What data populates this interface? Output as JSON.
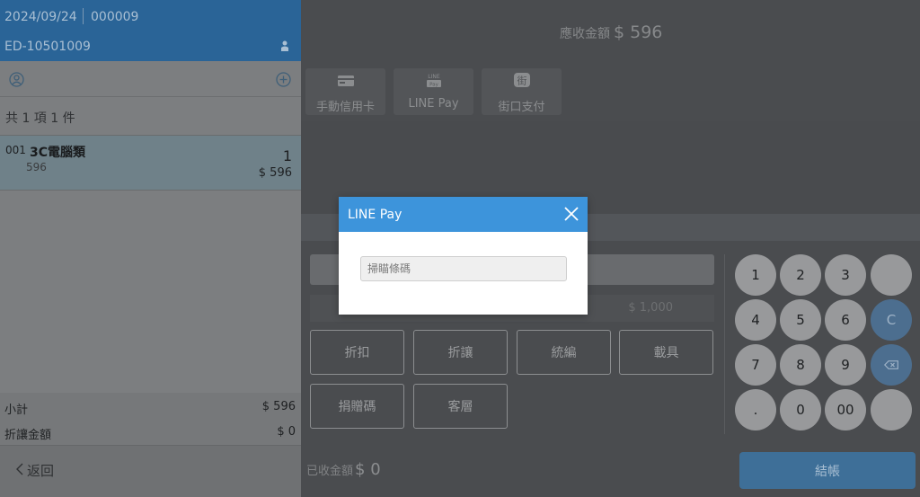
{
  "header": {
    "date": "2024/09/24",
    "order_no": "000009",
    "terminal": "ED-10501009"
  },
  "cart": {
    "count_text": "共 1 項 1 件",
    "items": [
      {
        "no": "001",
        "name": "3C電腦類",
        "unit_price": "596",
        "qty": "1",
        "amount": "$ 596"
      }
    ]
  },
  "totals": {
    "subtotal_label": "小計",
    "subtotal_value": "$ 596",
    "discount_label": "折讓金額",
    "discount_value": "$ 0"
  },
  "footer": {
    "back_label": "返回"
  },
  "payment": {
    "due_label": "應收金額",
    "due_amount": "$ 596",
    "methods": [
      {
        "label": "手動信用卡",
        "icon": "card-icon"
      },
      {
        "label": "LINE Pay",
        "icon": "line-pay-icon",
        "icon_text_top": "LINE",
        "icon_text_bottom": "Pay"
      },
      {
        "label": "街口支付",
        "icon": "jkopay-icon",
        "icon_text": "街"
      }
    ],
    "cash_quick": "$ 1,000",
    "actions": [
      "折扣",
      "折讓",
      "統編",
      "載具",
      "捐贈碼",
      "客層"
    ],
    "received_label": "已收金額",
    "received_amount": "$ 0",
    "checkout_label": "結帳"
  },
  "keypad": {
    "keys": [
      "1",
      "2",
      "3",
      "",
      "4",
      "5",
      "6",
      "C",
      "7",
      "8",
      "9",
      "backspace",
      ".",
      "0",
      "00",
      ""
    ]
  },
  "modal": {
    "title": "LINE Pay",
    "barcode_placeholder": "掃瞄條碼"
  },
  "colors": {
    "header_blue": "#2a6497",
    "modal_blue": "#3d94db",
    "checkout_blue": "#3e6f98"
  }
}
